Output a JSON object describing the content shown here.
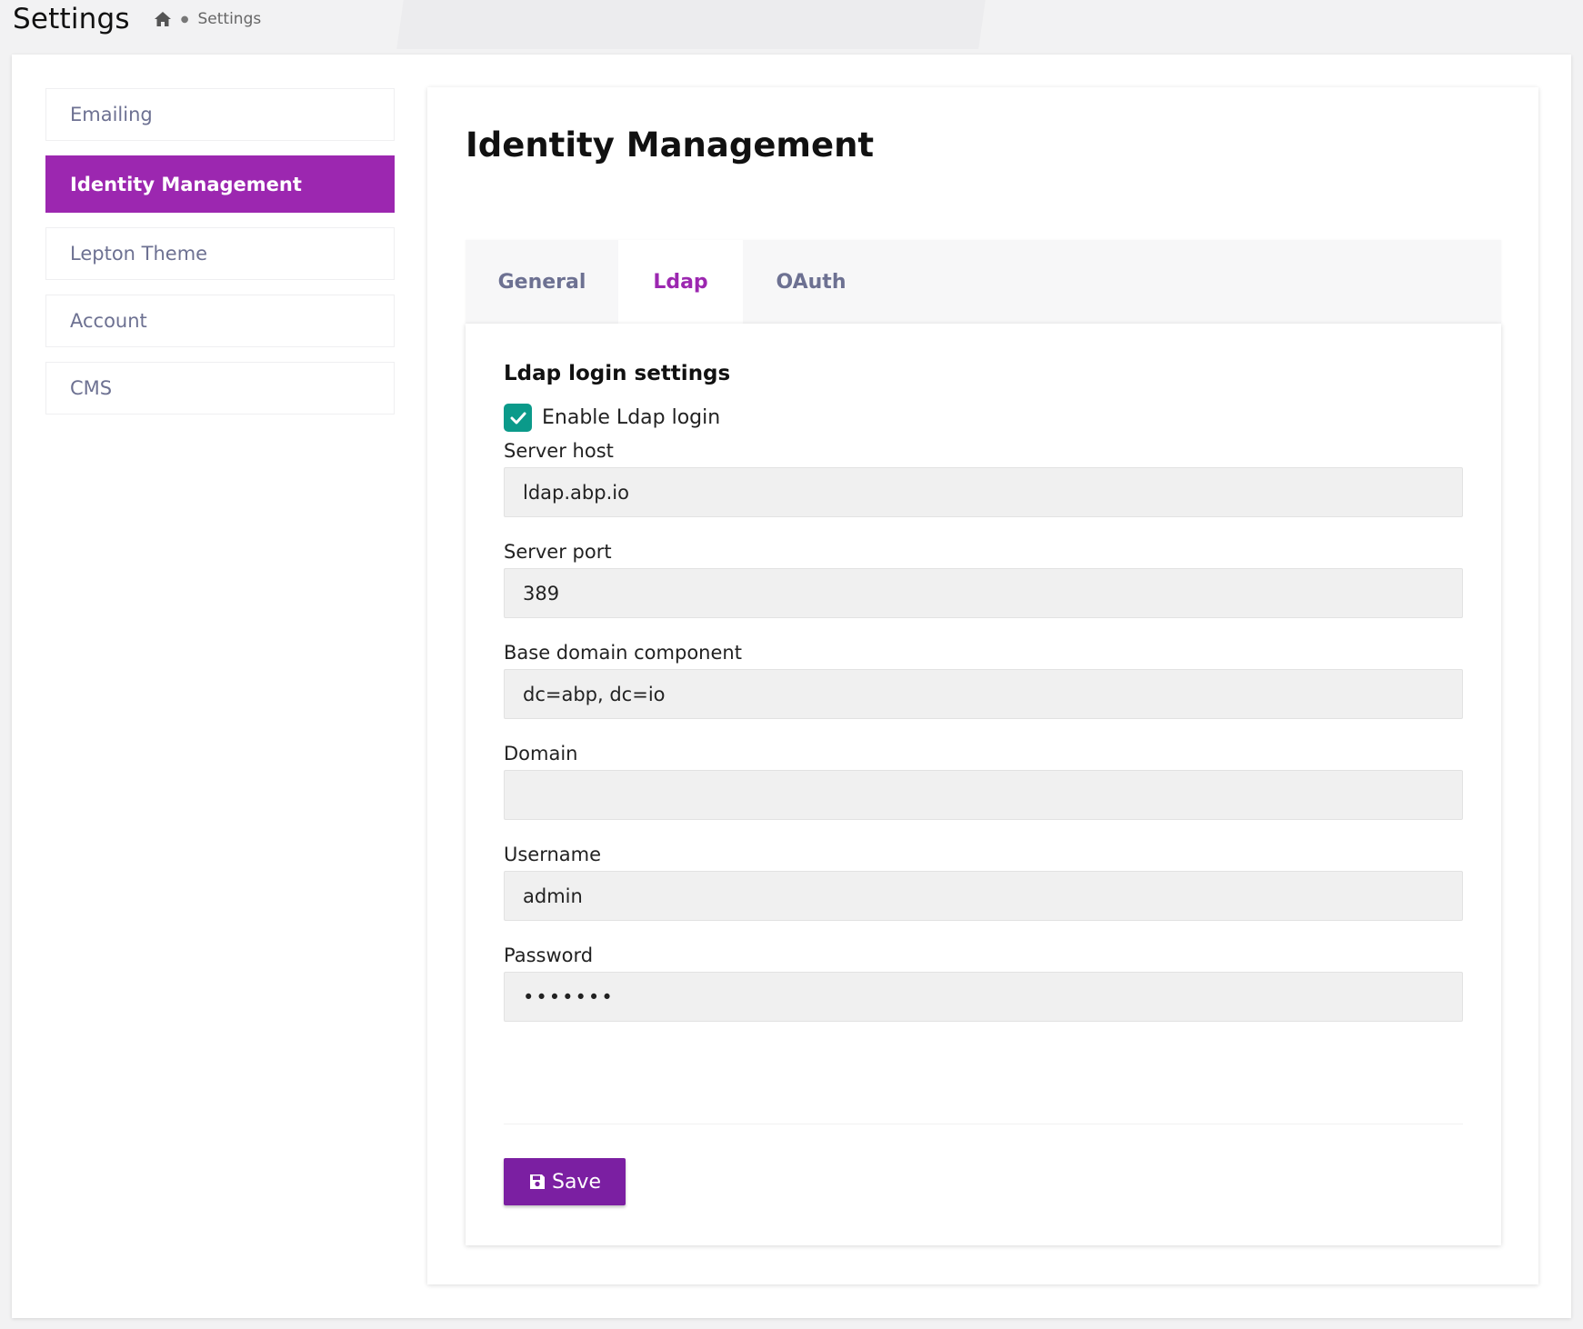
{
  "header": {
    "title": "Settings",
    "breadcrumb": {
      "home_icon": "home-icon",
      "current": "Settings"
    }
  },
  "sidebar": {
    "items": [
      {
        "label": "Emailing",
        "active": false
      },
      {
        "label": "Identity Management",
        "active": true
      },
      {
        "label": "Lepton Theme",
        "active": false
      },
      {
        "label": "Account",
        "active": false
      },
      {
        "label": "CMS",
        "active": false
      }
    ]
  },
  "main": {
    "title": "Identity Management",
    "tabs": [
      {
        "label": "General",
        "active": false
      },
      {
        "label": "Ldap",
        "active": true
      },
      {
        "label": "OAuth",
        "active": false
      }
    ],
    "ldap": {
      "section_title": "Ldap login settings",
      "enable_label": "Enable Ldap login",
      "enable_checked": true,
      "fields": [
        {
          "label": "Server host",
          "value": "ldap.abp.io"
        },
        {
          "label": "Server port",
          "value": "389"
        },
        {
          "label": "Base domain component",
          "value": "dc=abp, dc=io"
        },
        {
          "label": "Domain",
          "value": ""
        },
        {
          "label": "Username",
          "value": "admin"
        },
        {
          "label": "Password",
          "value": "•••••••"
        }
      ],
      "save_label": "Save",
      "save_icon": "floppy-disk-icon"
    }
  },
  "colors": {
    "accent": "#9c27b0",
    "save_button": "#7b1fa2",
    "checkbox": "#0b9a8a",
    "nav_text": "#6d7192"
  }
}
